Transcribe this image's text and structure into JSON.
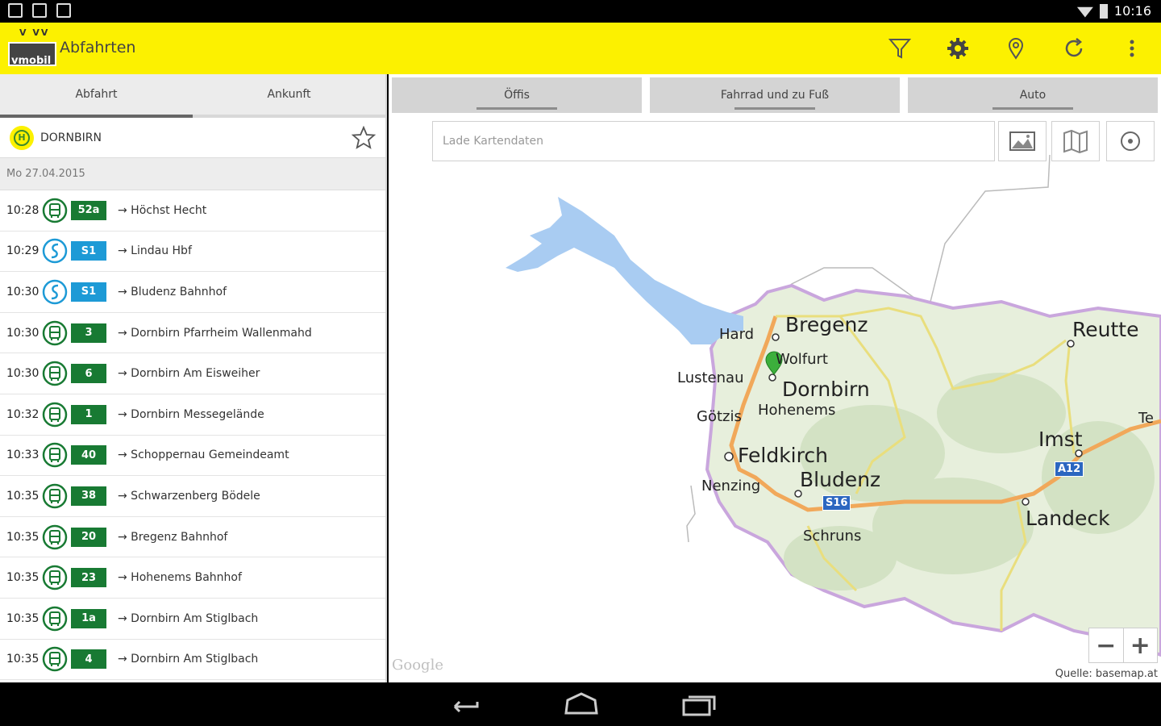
{
  "status_bar": {
    "time": "10:16"
  },
  "app_bar": {
    "logo_text": "vmobil",
    "logo_marks": "V VV",
    "title": "Abfahrten"
  },
  "left_tabs": [
    {
      "label": "Abfahrt",
      "active": true
    },
    {
      "label": "Ankunft",
      "active": false
    }
  ],
  "station": {
    "icon_text": "H",
    "name": "DORNBIRN"
  },
  "date": "Mo 27.04.2015",
  "departures": [
    {
      "time": "10:28",
      "mode": "bus",
      "line": "52a",
      "destination": "→ Höchst Hecht"
    },
    {
      "time": "10:29",
      "mode": "rail",
      "line": "S1",
      "destination": "→ Lindau Hbf"
    },
    {
      "time": "10:30",
      "mode": "rail",
      "line": "S1",
      "destination": "→ Bludenz Bahnhof"
    },
    {
      "time": "10:30",
      "mode": "bus",
      "line": "3",
      "destination": "→ Dornbirn Pfarrheim Wallenmahd"
    },
    {
      "time": "10:30",
      "mode": "bus",
      "line": "6",
      "destination": "→ Dornbirn Am Eisweiher"
    },
    {
      "time": "10:32",
      "mode": "bus",
      "line": "1",
      "destination": "→ Dornbirn Messegelände"
    },
    {
      "time": "10:33",
      "mode": "bus",
      "line": "40",
      "destination": "→ Schoppernau Gemeindeamt"
    },
    {
      "time": "10:35",
      "mode": "bus",
      "line": "38",
      "destination": "→ Schwarzenberg Bödele"
    },
    {
      "time": "10:35",
      "mode": "bus",
      "line": "20",
      "destination": "→ Bregenz Bahnhof"
    },
    {
      "time": "10:35",
      "mode": "bus",
      "line": "23",
      "destination": "→ Hohenems Bahnhof"
    },
    {
      "time": "10:35",
      "mode": "bus",
      "line": "1a",
      "destination": "→ Dornbirn Am Stiglbach"
    },
    {
      "time": "10:35",
      "mode": "bus",
      "line": "4",
      "destination": "→ Dornbirn Am Stiglbach"
    }
  ],
  "right_tabs": [
    {
      "label": "Öffis"
    },
    {
      "label": "Fahrrad und zu Fuß"
    },
    {
      "label": "Auto"
    }
  ],
  "map": {
    "search_text": "Lade Kartendaten",
    "labels": {
      "bregenz": "Bregenz",
      "hard": "Hard",
      "wolfurt": "Wolfurt",
      "lustenau": "Lustenau",
      "dornbirn": "Dornbirn",
      "hohenems": "Hohenems",
      "goetzis": "Götzis",
      "feldkirch": "Feldkirch",
      "bludenz": "Bludenz",
      "nenzing": "Nenzing",
      "schruns": "Schruns",
      "reutte": "Reutte",
      "imst": "Imst",
      "landeck": "Landeck",
      "te": "Te"
    },
    "shields": {
      "s16": "S16",
      "a12": "A12"
    },
    "google": "Google",
    "source": "Quelle: basemap.at",
    "zoom_out": "−",
    "zoom_in": "+"
  },
  "colors": {
    "appbar": "#fcf100",
    "bus_line": "#187a33",
    "rail_line": "#1d9ad6",
    "lake": "#a9ccf2",
    "land": "#e7efdc"
  }
}
